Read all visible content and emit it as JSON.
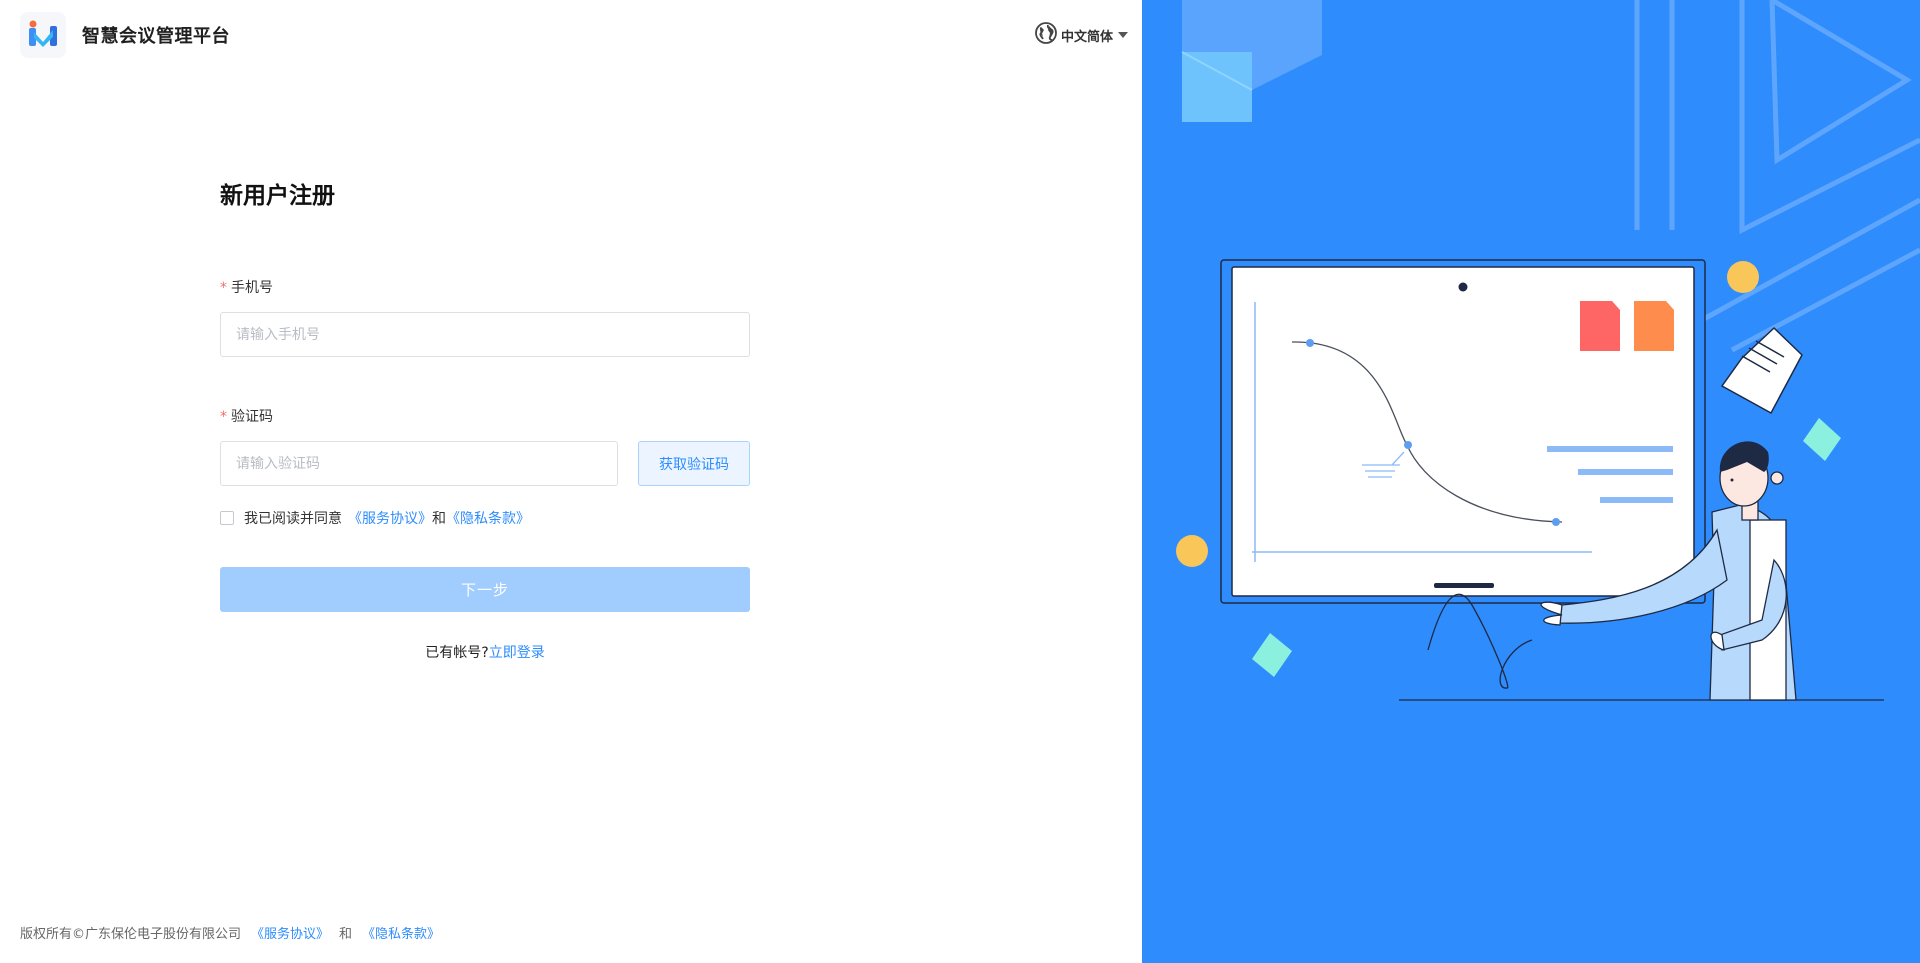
{
  "header": {
    "app_name": "智慧会议管理平台",
    "language": "中文简体"
  },
  "form": {
    "title": "新用户注册",
    "phone": {
      "label": "手机号",
      "required_mark": "*",
      "placeholder": "请输入手机号",
      "value": ""
    },
    "code": {
      "label": "验证码",
      "required_mark": "*",
      "placeholder": "请输入验证码",
      "value": "",
      "get_code_label": "获取验证码"
    },
    "agreement": {
      "checked": false,
      "prefix": "我已阅读并同意",
      "service_link": "《服务协议》",
      "and": "和",
      "privacy_link": "《隐私条款》"
    },
    "next_label": "下一步",
    "login_prompt": "已有帐号?",
    "login_link": "立即登录"
  },
  "footer": {
    "copyright": "版权所有©广东保伦电子股份有限公司",
    "service_link": "《服务协议》",
    "and": "和",
    "privacy_link": "《隐私条款》"
  },
  "colors": {
    "accent": "#2e8cfd",
    "panel_bg": "#2e8cfd",
    "button_disabled": "#a0cdfd",
    "required": "#f56c6c"
  },
  "icons": {
    "logo": "app-logo-icon",
    "globe": "globe-icon",
    "caret": "caret-down-icon"
  }
}
